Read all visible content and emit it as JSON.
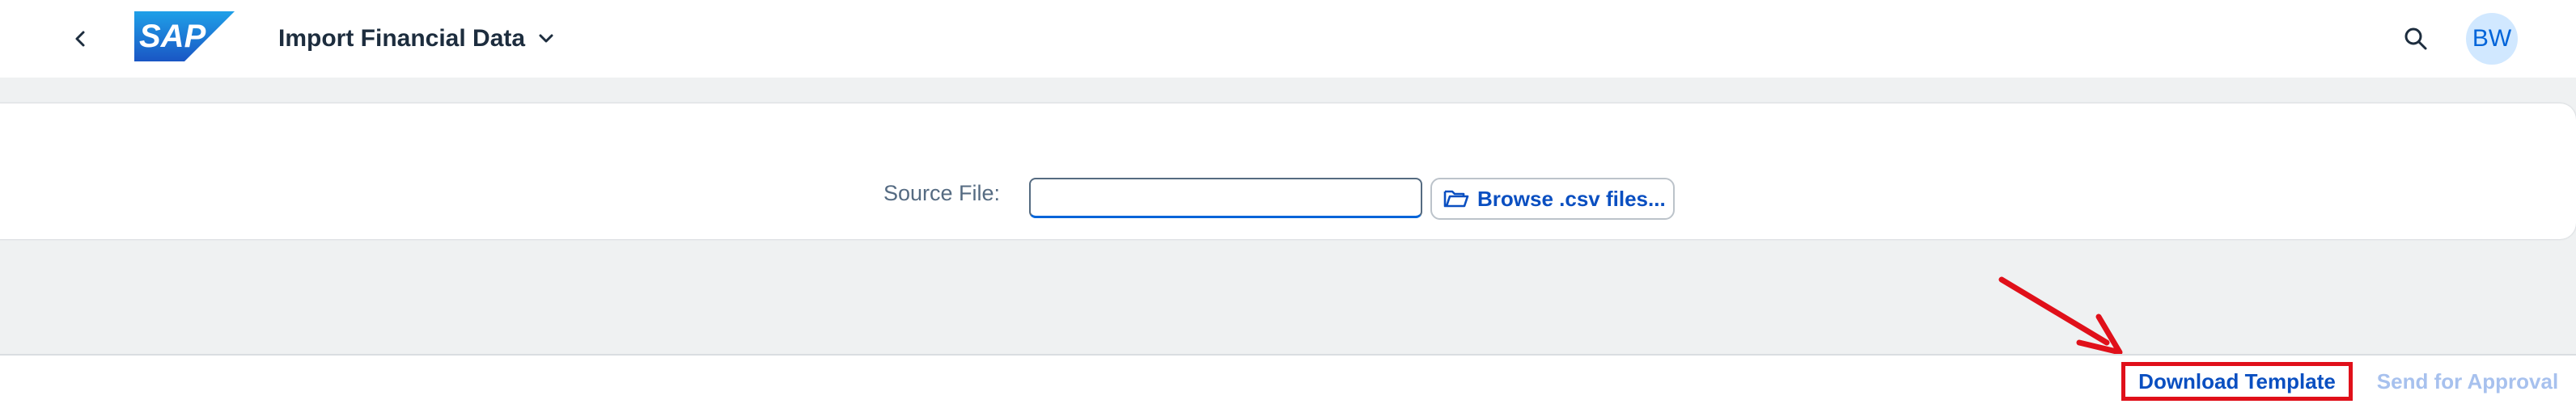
{
  "shellbar": {
    "title": "Import Financial Data",
    "logo_text": "SAP",
    "back_icon": "chevron-left-icon",
    "title_menu_icon": "chevron-down-icon",
    "search_icon": "search-icon",
    "avatar_initials": "BW"
  },
  "form": {
    "source_file_label": "Source File:",
    "source_file_value": "",
    "browse_label": "Browse .csv files...",
    "browse_icon": "open-folder-icon"
  },
  "footer": {
    "download_template_label": "Download Template",
    "send_for_approval_label": "Send for Approval",
    "send_for_approval_enabled": false
  },
  "colors": {
    "brand_blue": "#0064d9",
    "link_blue": "#0a4fc1",
    "disabled_blue": "#a7c1ee",
    "highlight_red": "#e0101a",
    "avatar_bg": "#d1e8ff",
    "page_bg": "#eff1f2"
  }
}
